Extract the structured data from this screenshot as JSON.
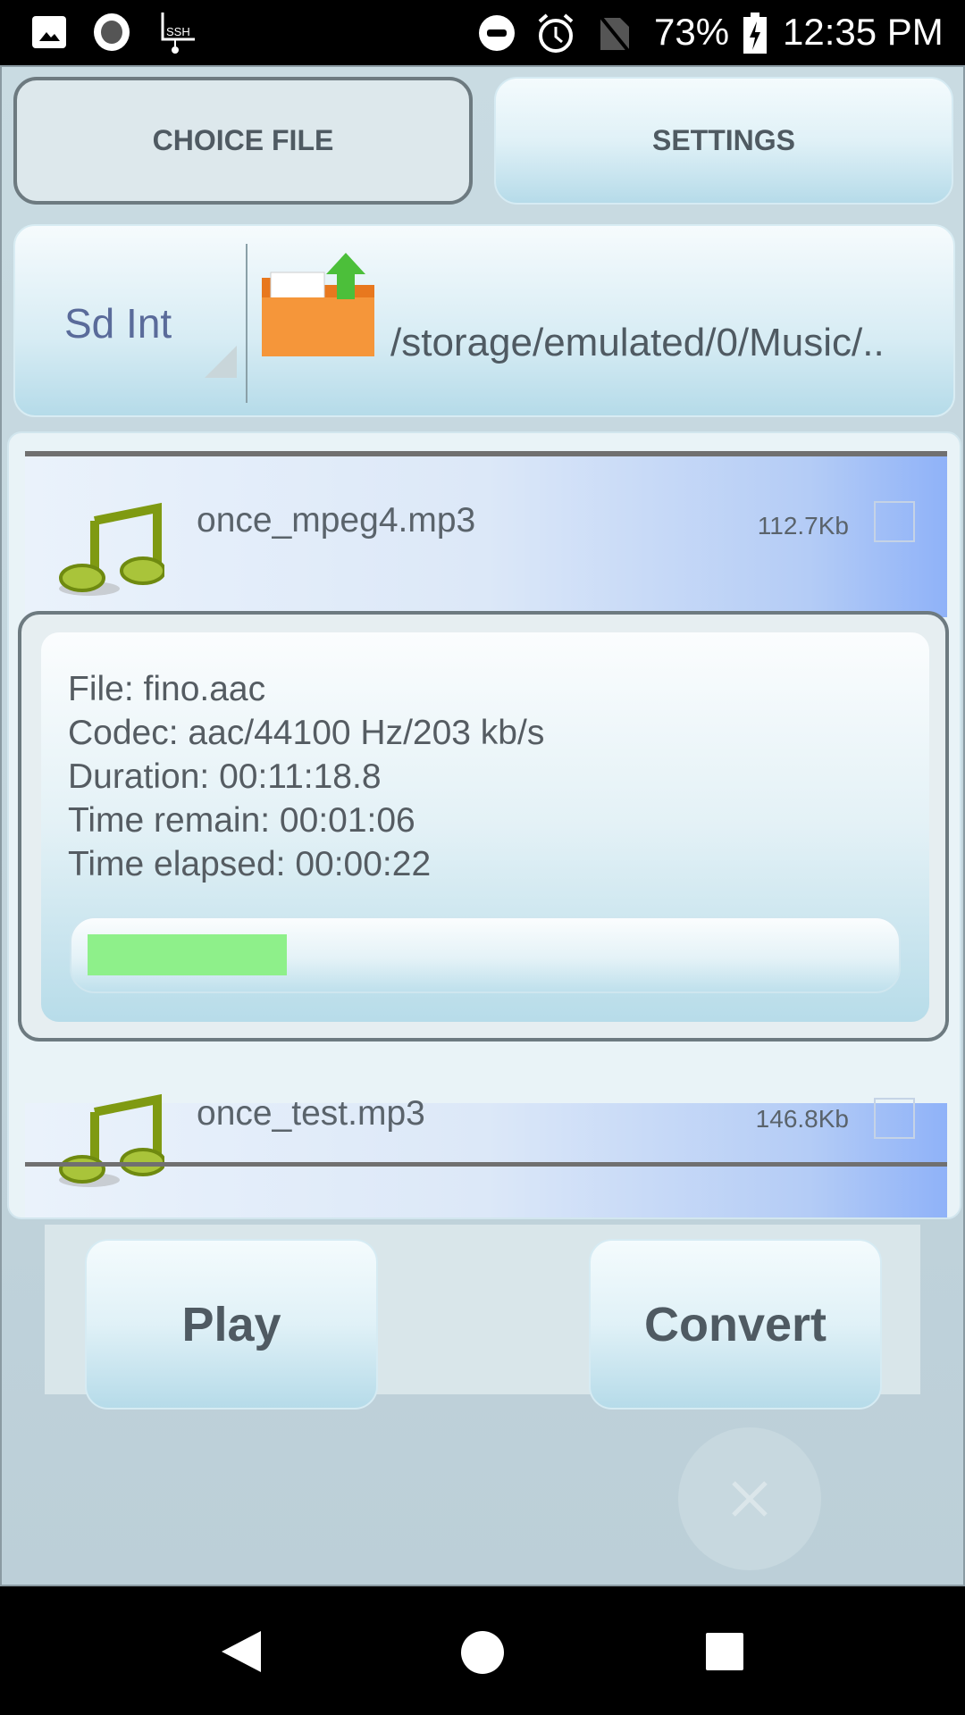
{
  "status_bar": {
    "battery": "73%",
    "time": "12:35 PM",
    "icons": [
      "image-icon",
      "record-icon",
      "ssh-icon",
      "dnd-icon",
      "alarm-icon",
      "no-sim-icon",
      "battery-charging-icon"
    ]
  },
  "top_buttons": {
    "choice_file": "CHOICE FILE",
    "settings": "SETTINGS"
  },
  "location": {
    "storage": "Sd Int",
    "path": "/storage/emulated/0/Music/.."
  },
  "files": [
    {
      "name": "once_mpeg4.mp3",
      "size": "112.7Kb",
      "checked": false
    },
    {
      "name": "once_test.mp3",
      "size": "146.8Kb",
      "checked": false
    }
  ],
  "progress_dialog": {
    "file": "File: fino.aac",
    "codec": "Codec: aac/44100 Hz/203 kb/s",
    "duration": "Duration: 00:11:18.8",
    "remain": "Time remain: 00:01:06",
    "elapsed": "Time elapsed: 00:00:22",
    "progress_percent": 25,
    "progress_color": "#8ef08a"
  },
  "actions": {
    "play": "Play",
    "convert": "Convert"
  },
  "colors": {
    "accent": "#b6dbe9",
    "list_highlight": "#8fb2f8"
  }
}
